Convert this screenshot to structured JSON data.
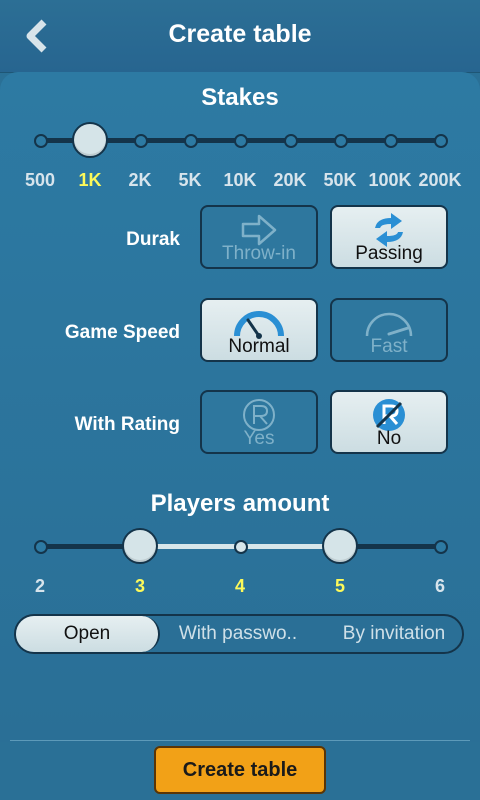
{
  "header": {
    "title": "Create table",
    "back_icon": "chevron-left-icon"
  },
  "stakes": {
    "title": "Stakes",
    "ticks": [
      "500",
      "1K",
      "2K",
      "5K",
      "10K",
      "20K",
      "50K",
      "100K",
      "200K"
    ],
    "selected_index": 1
  },
  "durak": {
    "label": "Durak",
    "options": [
      {
        "label": "Throw-in",
        "icon": "arrow-right-icon",
        "selected": false
      },
      {
        "label": "Passing",
        "icon": "swap-arrows-icon",
        "selected": true
      }
    ]
  },
  "game_speed": {
    "label": "Game Speed",
    "options": [
      {
        "label": "Normal",
        "icon": "speedometer-icon",
        "selected": true
      },
      {
        "label": "Fast",
        "icon": "speedometer-fast-icon",
        "selected": false
      }
    ]
  },
  "rating": {
    "label": "With Rating",
    "options": [
      {
        "label": "Yes",
        "icon": "rating-icon",
        "selected": false
      },
      {
        "label": "No",
        "icon": "no-rating-icon",
        "selected": true
      }
    ]
  },
  "players": {
    "title": "Players amount",
    "ticks": [
      "2",
      "3",
      "4",
      "5",
      "6"
    ],
    "range": [
      3,
      5
    ]
  },
  "access": {
    "options": [
      "Open",
      "With passwo..",
      "By invitation"
    ],
    "selected_index": 0
  },
  "create_button": {
    "label": "Create table"
  },
  "colors": {
    "accent": "#f2a117",
    "highlight": "#fcf95a",
    "background": "#2a7096"
  }
}
